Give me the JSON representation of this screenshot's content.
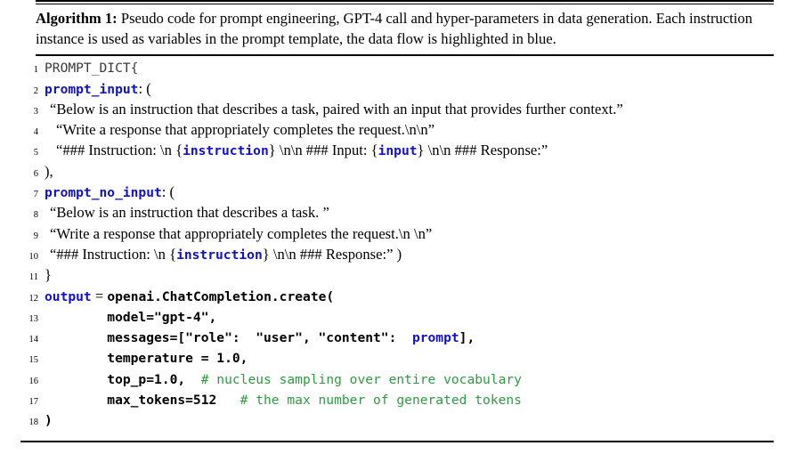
{
  "caption": {
    "label": "Algorithm 1:",
    "text": " Pseudo code for prompt engineering, GPT-4 call and hyper-parameters in data generation. Each instruction instance is used as variables in the prompt template, the data flow is highlighted in blue."
  },
  "colors": {
    "variable_blue": "#1010CE",
    "comment_green": "#2E9A42",
    "code_black": "#000000",
    "rule_black": "#000000",
    "background": "#FFFFFF"
  },
  "code": {
    "line_numbers": [
      "1",
      "2",
      "3",
      "4",
      "5",
      "6",
      "7",
      "8",
      "9",
      "10",
      "11",
      "12",
      "13",
      "14",
      "15",
      "16",
      "17",
      "18"
    ],
    "lines": [
      {
        "n": "1",
        "indent": 0,
        "tokens": [
          {
            "style": "mono-light",
            "text": "PROMPT_DICT{"
          }
        ]
      },
      {
        "n": "2",
        "indent": 0,
        "tokens": [
          {
            "style": "kw",
            "text": "prompt_input"
          },
          {
            "style": "prose",
            "text": ": ("
          }
        ]
      },
      {
        "n": "3",
        "indent": 1,
        "tokens": [
          {
            "style": "prose",
            "text": "“Below is an instruction that describes a task, paired with an input that provides further context.”"
          }
        ]
      },
      {
        "n": "4",
        "indent": 2,
        "tokens": [
          {
            "style": "prose",
            "text": "“Write a response that appropriately completes the request.\\n\\n”"
          }
        ]
      },
      {
        "n": "5",
        "indent": 2,
        "tokens": [
          {
            "style": "prose",
            "text": "“### Instruction: \\n {"
          },
          {
            "style": "kw",
            "text": "instruction"
          },
          {
            "style": "prose",
            "text": "} \\n\\n ### Input: {"
          },
          {
            "style": "kw",
            "text": "input"
          },
          {
            "style": "prose",
            "text": "} \\n\\n ### Response:”"
          }
        ]
      },
      {
        "n": "6",
        "indent": 0,
        "tokens": [
          {
            "style": "prose",
            "text": "),"
          }
        ]
      },
      {
        "n": "7",
        "indent": 0,
        "tokens": [
          {
            "style": "kw",
            "text": "prompt_no_input"
          },
          {
            "style": "prose",
            "text": ": ("
          }
        ]
      },
      {
        "n": "8",
        "indent": 1,
        "tokens": [
          {
            "style": "prose",
            "text": "“Below is an instruction that describes a task. ”"
          }
        ]
      },
      {
        "n": "9",
        "indent": 1,
        "tokens": [
          {
            "style": "prose",
            "text": "“Write a response that appropriately completes the request.\\n \\n”"
          }
        ]
      },
      {
        "n": "10",
        "indent": 1,
        "tokens": [
          {
            "style": "prose",
            "text": "“### Instruction: \\n {"
          },
          {
            "style": "kw",
            "text": "instruction"
          },
          {
            "style": "prose",
            "text": "} \\n\\n ### Response:” )"
          }
        ]
      },
      {
        "n": "11",
        "indent": 0,
        "tokens": [
          {
            "style": "prose",
            "text": "}"
          }
        ]
      },
      {
        "n": "12",
        "indent": 0,
        "tokens": [
          {
            "style": "kw",
            "text": "output"
          },
          {
            "style": "prose",
            "text": " = "
          },
          {
            "style": "kb",
            "text": "openai.ChatCompletion.create("
          }
        ]
      },
      {
        "n": "13",
        "indent": 0,
        "tokens": [
          {
            "style": "kb",
            "text": "        model=\"gpt-4\","
          }
        ]
      },
      {
        "n": "14",
        "indent": 0,
        "tokens": [
          {
            "style": "kb",
            "text": "        messages=[\"role\":  \"user\", \"content\":  "
          },
          {
            "style": "kw",
            "text": "prompt"
          },
          {
            "style": "kb",
            "text": "],"
          }
        ]
      },
      {
        "n": "15",
        "indent": 0,
        "tokens": [
          {
            "style": "kb",
            "text": "        temperature = 1.0,"
          }
        ]
      },
      {
        "n": "16",
        "indent": 0,
        "tokens": [
          {
            "style": "kb",
            "text": "        top_p=1.0,  "
          },
          {
            "style": "cm",
            "text": "# nucleus sampling over entire vocabulary"
          }
        ]
      },
      {
        "n": "17",
        "indent": 0,
        "tokens": [
          {
            "style": "kb",
            "text": "        max_tokens=512   "
          },
          {
            "style": "cm",
            "text": "# the max number of generated tokens"
          }
        ]
      },
      {
        "n": "18",
        "indent": 0,
        "tokens": [
          {
            "style": "kb",
            "text": ")"
          }
        ]
      }
    ]
  }
}
